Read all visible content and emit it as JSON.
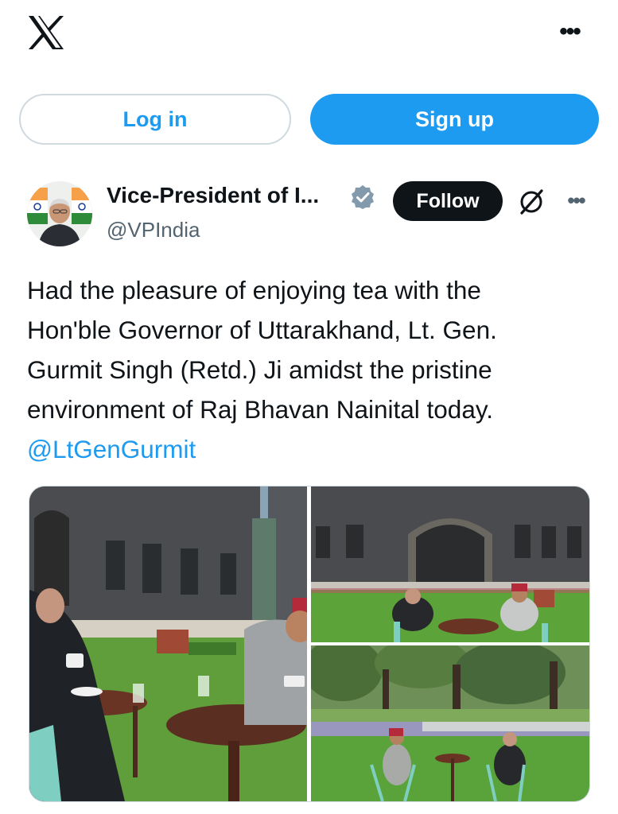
{
  "header": {
    "logo_icon": "x-logo-icon",
    "more_icon": "more-horizontal-icon",
    "more_label": "•••"
  },
  "auth": {
    "login_label": "Log in",
    "signup_label": "Sign up"
  },
  "post": {
    "author_name": "Vice-President of I...",
    "handle": "@VPIndia",
    "verified_icon": "verified-badge-icon",
    "follow_label": "Follow",
    "grok_icon": "grok-icon",
    "more_label": "•••",
    "text_lines": [
      "Had the pleasure of enjoying tea with the",
      "Hon'ble Governor of Uttarakhand, Lt. Gen.",
      "Gurmit Singh (Retd.) Ji amidst the pristine",
      "environment of Raj Bhavan Nainital today."
    ],
    "mention": "@LtGenGurmit",
    "media": [
      {
        "name": "photo-tea-closeup"
      },
      {
        "name": "photo-raj-bhavan-lawn"
      },
      {
        "name": "photo-garden-view"
      }
    ]
  },
  "colors": {
    "accent": "#1d9bf0",
    "text": "#0f1419",
    "secondary": "#536471",
    "border": "#cfd9de"
  }
}
